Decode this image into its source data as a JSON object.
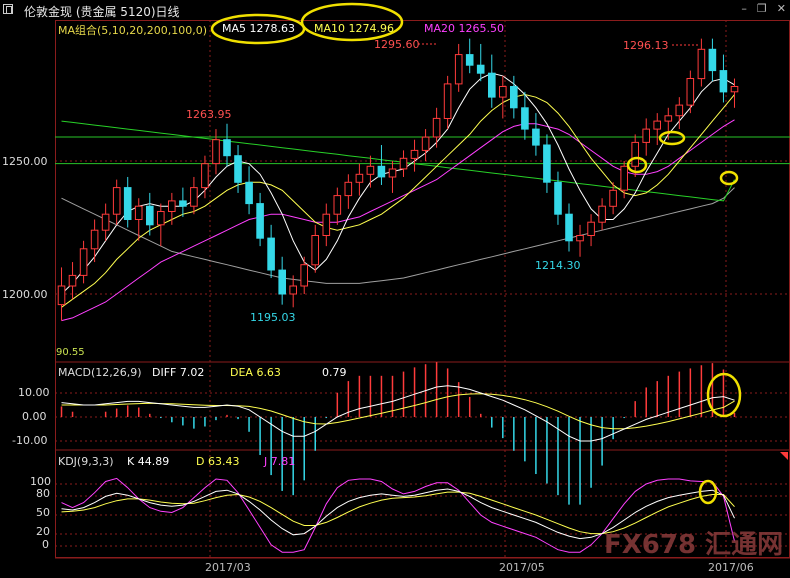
{
  "header": {
    "title": "伦敦金现 (贵金属 5120)日线",
    "window_buttons": [
      "–",
      "❐",
      "✕"
    ]
  },
  "main_panel": {
    "indicator_label": "MA组合(5,10,20,200,100,0)",
    "ma5": "MA5 1278.63",
    "ma10": "MA10 1274.96",
    "ma20": "MA20 1265.50",
    "price_annotations": {
      "p1295": "1295.60",
      "p1296": "1296.13",
      "p1263": "1263.95",
      "p1195": "1195.03",
      "p1214": "1214.30"
    },
    "corner_value": "90.55",
    "y_ticks": [
      "1250.00",
      "1200.00"
    ]
  },
  "macd_panel": {
    "name": "MACD(12,26,9)",
    "diff": "DIFF  7.02",
    "dea": "DEA  6.63",
    "macd": "0.79",
    "y_ticks": [
      "10.00",
      "0.00",
      "-10.00"
    ]
  },
  "kdj_panel": {
    "name": "KDJ(9,3,3)",
    "k": "K  44.89",
    "d": "D  63.43",
    "j": "J  7.81",
    "y_ticks": [
      "100",
      "80",
      "50",
      "20",
      "0"
    ]
  },
  "x_axis": {
    "labels": [
      "2017/03",
      "2017/05",
      "2017/06"
    ]
  },
  "watermark": "FX678 汇通网",
  "colors": {
    "up": "#ff3b3b",
    "down": "#35d8e8",
    "ma5": "#ffffff",
    "ma10": "#ffff50",
    "ma20": "#ff40ff",
    "ma100": "#28d028",
    "ma200": "#a0a0a0",
    "hline": "#28c428",
    "highlight": "#f0e000",
    "grid_red": "#8a1c1c"
  },
  "chart_data": {
    "type": "candlestick",
    "title": "伦敦金现 日线",
    "price_ylim": [
      1180,
      1305
    ],
    "horizontal_levels": [
      1259,
      1249
    ],
    "candles": [
      [
        1196,
        1210,
        1190,
        1203
      ],
      [
        1203,
        1212,
        1198,
        1207
      ],
      [
        1207,
        1220,
        1204,
        1217
      ],
      [
        1217,
        1228,
        1212,
        1224
      ],
      [
        1224,
        1234,
        1220,
        1230
      ],
      [
        1230,
        1243,
        1226,
        1240
      ],
      [
        1240,
        1244,
        1225,
        1228
      ],
      [
        1228,
        1236,
        1220,
        1233
      ],
      [
        1233,
        1238,
        1222,
        1226
      ],
      [
        1226,
        1234,
        1218,
        1231
      ],
      [
        1231,
        1238,
        1226,
        1235
      ],
      [
        1235,
        1240,
        1229,
        1233
      ],
      [
        1233,
        1244,
        1230,
        1240
      ],
      [
        1240,
        1252,
        1236,
        1249
      ],
      [
        1249,
        1262,
        1245,
        1258
      ],
      [
        1258,
        1264,
        1248,
        1252
      ],
      [
        1252,
        1256,
        1238,
        1242
      ],
      [
        1242,
        1248,
        1230,
        1234
      ],
      [
        1234,
        1238,
        1218,
        1221
      ],
      [
        1221,
        1226,
        1206,
        1209
      ],
      [
        1209,
        1214,
        1196,
        1200
      ],
      [
        1200,
        1207,
        1195,
        1203
      ],
      [
        1203,
        1214,
        1200,
        1211
      ],
      [
        1211,
        1226,
        1208,
        1222
      ],
      [
        1222,
        1234,
        1218,
        1230
      ],
      [
        1230,
        1240,
        1226,
        1237
      ],
      [
        1237,
        1245,
        1232,
        1242
      ],
      [
        1242,
        1249,
        1237,
        1245
      ],
      [
        1245,
        1252,
        1240,
        1248
      ],
      [
        1248,
        1256,
        1241,
        1244
      ],
      [
        1244,
        1250,
        1238,
        1247
      ],
      [
        1247,
        1254,
        1244,
        1251
      ],
      [
        1251,
        1258,
        1246,
        1254
      ],
      [
        1254,
        1262,
        1250,
        1259
      ],
      [
        1259,
        1270,
        1255,
        1266
      ],
      [
        1266,
        1282,
        1262,
        1279
      ],
      [
        1279,
        1294,
        1276,
        1290
      ],
      [
        1290,
        1296,
        1283,
        1286
      ],
      [
        1286,
        1294,
        1280,
        1283
      ],
      [
        1283,
        1290,
        1270,
        1274
      ],
      [
        1274,
        1282,
        1266,
        1278
      ],
      [
        1278,
        1282,
        1266,
        1270
      ],
      [
        1270,
        1276,
        1258,
        1262
      ],
      [
        1262,
        1268,
        1252,
        1256
      ],
      [
        1256,
        1260,
        1238,
        1242
      ],
      [
        1242,
        1246,
        1226,
        1230
      ],
      [
        1230,
        1234,
        1216,
        1220
      ],
      [
        1220,
        1226,
        1214,
        1222
      ],
      [
        1222,
        1230,
        1218,
        1227
      ],
      [
        1227,
        1236,
        1224,
        1233
      ],
      [
        1233,
        1242,
        1230,
        1239
      ],
      [
        1239,
        1250,
        1236,
        1248
      ],
      [
        1248,
        1260,
        1244,
        1257
      ],
      [
        1257,
        1266,
        1252,
        1262
      ],
      [
        1262,
        1268,
        1256,
        1265
      ],
      [
        1265,
        1270,
        1258,
        1267
      ],
      [
        1267,
        1274,
        1262,
        1271
      ],
      [
        1271,
        1284,
        1268,
        1281
      ],
      [
        1281,
        1296,
        1278,
        1292
      ],
      [
        1292,
        1296,
        1280,
        1284
      ],
      [
        1284,
        1290,
        1272,
        1276
      ],
      [
        1276,
        1281,
        1270,
        1278
      ]
    ],
    "ma5": [
      1200,
      1204,
      1209,
      1214,
      1220,
      1226,
      1231,
      1233,
      1234,
      1233,
      1233,
      1233,
      1235,
      1239,
      1244,
      1248,
      1250,
      1249,
      1245,
      1238,
      1230,
      1220,
      1212,
      1209,
      1213,
      1220,
      1229,
      1236,
      1242,
      1245,
      1246,
      1247,
      1250,
      1253,
      1257,
      1262,
      1270,
      1277,
      1281,
      1283,
      1282,
      1279,
      1275,
      1270,
      1264,
      1256,
      1247,
      1239,
      1232,
      1228,
      1228,
      1232,
      1238,
      1246,
      1253,
      1260,
      1265,
      1270,
      1276,
      1280,
      1281,
      1278.63
    ],
    "ma10": [
      1195,
      1198,
      1201,
      1204,
      1208,
      1213,
      1217,
      1221,
      1224,
      1226,
      1228,
      1230,
      1231,
      1233,
      1236,
      1239,
      1241,
      1242,
      1242,
      1241,
      1239,
      1235,
      1231,
      1227,
      1225,
      1224,
      1225,
      1226,
      1228,
      1230,
      1233,
      1236,
      1240,
      1244,
      1248,
      1252,
      1256,
      1260,
      1265,
      1269,
      1272,
      1274,
      1275,
      1274,
      1272,
      1268,
      1263,
      1257,
      1251,
      1246,
      1241,
      1238,
      1237,
      1238,
      1241,
      1245,
      1250,
      1255,
      1260,
      1265,
      1270,
      1274.96
    ],
    "ma20": [
      1190,
      1191,
      1193,
      1195,
      1197,
      1200,
      1203,
      1206,
      1209,
      1212,
      1214,
      1216,
      1218,
      1220,
      1222,
      1224,
      1226,
      1228,
      1229,
      1230,
      1230,
      1229,
      1228,
      1227,
      1227,
      1227,
      1228,
      1229,
      1231,
      1233,
      1235,
      1237,
      1239,
      1241,
      1243,
      1246,
      1249,
      1252,
      1255,
      1258,
      1261,
      1263,
      1264,
      1264,
      1263,
      1262,
      1260,
      1257,
      1254,
      1251,
      1248,
      1246,
      1245,
      1245,
      1246,
      1248,
      1251,
      1254,
      1257,
      1260,
      1263,
      1265.5
    ],
    "ma100": [
      1265,
      1264.5,
      1264,
      1263.5,
      1263,
      1262.5,
      1262,
      1261.5,
      1261,
      1260.5,
      1260,
      1259.5,
      1259,
      1258.5,
      1258,
      1257.5,
      1257,
      1256.5,
      1256,
      1255.5,
      1255,
      1254.5,
      1254,
      1253.5,
      1253,
      1252.5,
      1252,
      1251.5,
      1251,
      1250.5,
      1250,
      1249.5,
      1249,
      1248.5,
      1248,
      1247.5,
      1247,
      1246.5,
      1246,
      1245.5,
      1245,
      1244.5,
      1244,
      1243.5,
      1243,
      1242.5,
      1242,
      1241.5,
      1241,
      1240.5,
      1240,
      1239.5,
      1239,
      1238.5,
      1238,
      1237.5,
      1237,
      1236.5,
      1236,
      1235.5,
      1235,
      1243
    ],
    "ma200": [
      1236,
      1234,
      1232,
      1230,
      1228,
      1226,
      1224,
      1222,
      1220,
      1218,
      1216,
      1215,
      1214,
      1213,
      1212,
      1211,
      1210,
      1209,
      1208,
      1207,
      1206,
      1205.5,
      1205,
      1204.5,
      1204,
      1204,
      1204,
      1204,
      1204.5,
      1205,
      1205.5,
      1206,
      1207,
      1208,
      1209,
      1210,
      1211,
      1212,
      1213,
      1214,
      1215,
      1216,
      1217,
      1218,
      1219,
      1220,
      1221,
      1222,
      1223,
      1224,
      1225,
      1226,
      1227,
      1228,
      1229,
      1230,
      1231,
      1232,
      1233,
      1234,
      1236,
      1240
    ],
    "macd_ylim": [
      -14,
      16
    ],
    "diff": [
      6,
      5.5,
      5,
      5,
      5.5,
      6,
      6.5,
      6.5,
      6,
      5.5,
      5,
      4.5,
      4,
      4,
      4.5,
      5,
      4.5,
      3,
      0,
      -3,
      -6,
      -8,
      -8,
      -6,
      -3,
      0,
      2,
      3.5,
      4.5,
      5.5,
      6.5,
      8,
      9.5,
      11,
      12.5,
      13,
      12.5,
      11.5,
      10,
      8.5,
      7,
      5,
      3,
      0.5,
      -2,
      -5,
      -8,
      -10,
      -10,
      -9,
      -7,
      -5,
      -3,
      -1,
      0.5,
      2,
      3.5,
      5,
      6.5,
      8,
      8.5,
      7.02
    ],
    "dea": [
      5,
      5,
      5,
      5,
      5,
      5.2,
      5.4,
      5.6,
      5.7,
      5.6,
      5.5,
      5.3,
      5.1,
      4.9,
      4.8,
      4.8,
      4.7,
      4.4,
      3.6,
      2.5,
      1,
      -0.6,
      -2,
      -2.8,
      -2.9,
      -2.3,
      -1.4,
      -0.4,
      0.6,
      1.6,
      2.6,
      3.7,
      4.8,
      6,
      7.3,
      8.4,
      9.2,
      9.6,
      9.7,
      9.5,
      9,
      8.2,
      7.2,
      5.9,
      4.3,
      2.4,
      0.3,
      -1.7,
      -3.3,
      -4.4,
      -4.9,
      -4.9,
      -4.5,
      -3.8,
      -2.9,
      -1.9,
      -0.8,
      0.4,
      1.6,
      2.9,
      4,
      6.63
    ],
    "kdj_ylim": [
      -10,
      115
    ],
    "k": [
      60,
      58,
      62,
      70,
      80,
      85,
      82,
      76,
      70,
      66,
      64,
      66,
      72,
      80,
      88,
      90,
      84,
      72,
      58,
      42,
      28,
      18,
      20,
      32,
      48,
      62,
      72,
      78,
      82,
      84,
      82,
      80,
      82,
      86,
      90,
      92,
      88,
      80,
      70,
      62,
      56,
      50,
      44,
      38,
      30,
      22,
      16,
      12,
      14,
      20,
      30,
      42,
      54,
      64,
      72,
      78,
      82,
      85,
      88,
      90,
      82,
      44.89
    ],
    "d": [
      55,
      56,
      58,
      62,
      68,
      73,
      76,
      76,
      74,
      71,
      69,
      68,
      69,
      73,
      78,
      82,
      83,
      79,
      72,
      62,
      51,
      40,
      33,
      33,
      38,
      46,
      55,
      63,
      69,
      74,
      77,
      78,
      79,
      81,
      84,
      87,
      87,
      85,
      80,
      74,
      68,
      62,
      56,
      50,
      43,
      36,
      29,
      23,
      20,
      20,
      23,
      29,
      37,
      46,
      55,
      63,
      69,
      75,
      80,
      83,
      83,
      63.43
    ],
    "j": [
      70,
      62,
      70,
      86,
      104,
      109,
      94,
      76,
      62,
      56,
      54,
      62,
      78,
      94,
      108,
      106,
      86,
      58,
      30,
      2,
      -10,
      -10,
      -6,
      30,
      68,
      94,
      106,
      108,
      108,
      104,
      92,
      84,
      88,
      96,
      102,
      102,
      90,
      70,
      50,
      38,
      32,
      26,
      20,
      14,
      4,
      -6,
      -10,
      -10,
      2,
      20,
      44,
      68,
      88,
      100,
      106,
      108,
      108,
      105,
      104,
      104,
      80,
      7.81
    ]
  }
}
